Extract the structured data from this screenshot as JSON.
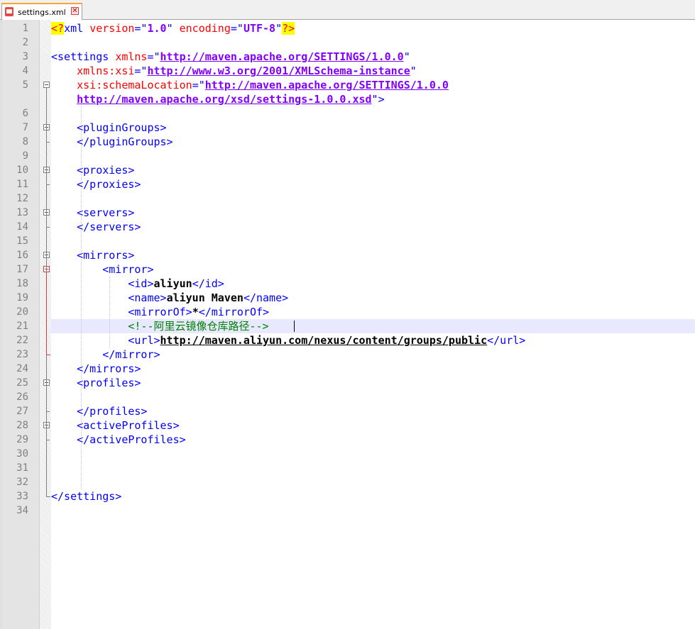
{
  "tab": {
    "filename": "settings.xml",
    "close_glyph": "✕",
    "icon": "file-modified-icon"
  },
  "editor": {
    "active_line": 21,
    "lines": [
      {
        "num": "1",
        "parts": [
          [
            "pi",
            "<?"
          ],
          [
            "tag",
            "xml "
          ],
          [
            "kw",
            "version"
          ],
          [
            "tag",
            "=\""
          ],
          [
            "val",
            "1.0"
          ],
          [
            "tag",
            "\" "
          ],
          [
            "kw",
            "encoding"
          ],
          [
            "tag",
            "=\""
          ],
          [
            "val",
            "UTF-8"
          ],
          [
            "tag",
            "\""
          ],
          [
            "pi",
            "?>"
          ]
        ]
      },
      {
        "num": "2",
        "parts": []
      },
      {
        "num": "3",
        "parts": [
          [
            "tag",
            "<settings "
          ],
          [
            "attr",
            "xmlns"
          ],
          [
            "tag",
            "=\""
          ],
          [
            "url",
            "http://maven.apache.org/SETTINGS/1.0.0"
          ],
          [
            "tag",
            "\""
          ]
        ]
      },
      {
        "num": "4",
        "parts": [
          [
            "tag",
            "    "
          ],
          [
            "attr",
            "xmlns:xsi"
          ],
          [
            "tag",
            "=\""
          ],
          [
            "url",
            "http://www.w3.org/2001/XMLSchema-instance"
          ],
          [
            "tag",
            "\""
          ]
        ]
      },
      {
        "num": "5",
        "parts": [
          [
            "tag",
            "    "
          ],
          [
            "attr",
            "xsi:schemaLocation"
          ],
          [
            "tag",
            "=\""
          ],
          [
            "url",
            "http://maven.apache.org/SETTINGS/1.0.0"
          ]
        ]
      },
      {
        "num": "",
        "parts": [
          [
            "tag",
            "    "
          ],
          [
            "url",
            "http://maven.apache.org/xsd/settings-1.0.0.xsd"
          ],
          [
            "tag",
            "\">"
          ]
        ]
      },
      {
        "num": "6",
        "parts": []
      },
      {
        "num": "7",
        "parts": [
          [
            "tag",
            "    <pluginGroups>"
          ]
        ]
      },
      {
        "num": "8",
        "parts": [
          [
            "tag",
            "    </pluginGroups>"
          ]
        ]
      },
      {
        "num": "9",
        "parts": []
      },
      {
        "num": "10",
        "parts": [
          [
            "tag",
            "    <proxies>"
          ]
        ]
      },
      {
        "num": "11",
        "parts": [
          [
            "tag",
            "    </proxies>"
          ]
        ]
      },
      {
        "num": "12",
        "parts": []
      },
      {
        "num": "13",
        "parts": [
          [
            "tag",
            "    <servers>"
          ]
        ]
      },
      {
        "num": "14",
        "parts": [
          [
            "tag",
            "    </servers>"
          ]
        ]
      },
      {
        "num": "15",
        "parts": []
      },
      {
        "num": "16",
        "parts": [
          [
            "tag",
            "    <mirrors>"
          ]
        ]
      },
      {
        "num": "17",
        "parts": [
          [
            "tag",
            "        <mirror>"
          ]
        ]
      },
      {
        "num": "18",
        "parts": [
          [
            "tag",
            "            <id>"
          ],
          [
            "txt",
            "aliyun"
          ],
          [
            "tag",
            "</id>"
          ]
        ]
      },
      {
        "num": "19",
        "parts": [
          [
            "tag",
            "            <name>"
          ],
          [
            "txt",
            "aliyun Maven"
          ],
          [
            "tag",
            "</name>"
          ]
        ]
      },
      {
        "num": "20",
        "parts": [
          [
            "tag",
            "            <mirrorOf>"
          ],
          [
            "txt",
            "*"
          ],
          [
            "tag",
            "</mirrorOf>"
          ]
        ]
      },
      {
        "num": "21",
        "parts": [
          [
            "tag",
            "            "
          ],
          [
            "cmt",
            "<!--阿里云镜像仓库路径-->"
          ]
        ]
      },
      {
        "num": "22",
        "parts": [
          [
            "tag",
            "            <url>"
          ],
          [
            "txturl",
            "http://maven.aliyun.com/nexus/content/groups/public"
          ],
          [
            "tag",
            "</url>"
          ]
        ]
      },
      {
        "num": "23",
        "parts": [
          [
            "tag",
            "        </mirror>"
          ]
        ]
      },
      {
        "num": "24",
        "parts": [
          [
            "tag",
            "    </mirrors>"
          ]
        ]
      },
      {
        "num": "25",
        "parts": [
          [
            "tag",
            "    <profiles>"
          ]
        ]
      },
      {
        "num": "26",
        "parts": []
      },
      {
        "num": "27",
        "parts": [
          [
            "tag",
            "    </profiles>"
          ]
        ]
      },
      {
        "num": "28",
        "parts": [
          [
            "tag",
            "    <activeProfiles>"
          ]
        ]
      },
      {
        "num": "29",
        "parts": [
          [
            "tag",
            "    </activeProfiles>"
          ]
        ]
      },
      {
        "num": "30",
        "parts": []
      },
      {
        "num": "31",
        "parts": []
      },
      {
        "num": "32",
        "parts": []
      },
      {
        "num": "33",
        "parts": [
          [
            "tag",
            "</settings>"
          ]
        ]
      },
      {
        "num": "34",
        "parts": []
      }
    ]
  }
}
